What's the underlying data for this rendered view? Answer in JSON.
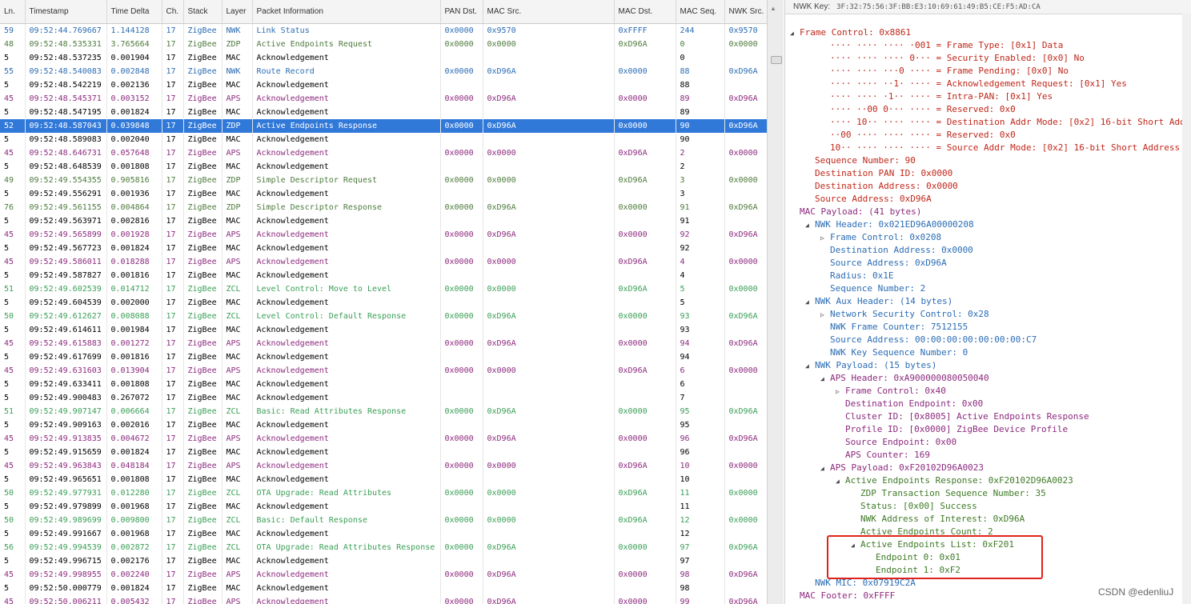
{
  "table": {
    "headers": [
      "Ln.",
      "Timestamp",
      "Time Delta",
      "Ch.",
      "Stack",
      "Layer",
      "Packet Information",
      "PAN Dst.",
      "MAC Src.",
      "MAC Dst.",
      "MAC Seq.",
      "NWK Src."
    ],
    "rows": [
      {
        "cat": "nwk",
        "cells": [
          "59",
          "09:52:44.769667",
          "1.144128",
          "17",
          "ZigBee",
          "NWK",
          "Link Status",
          "0x0000",
          "0x9570",
          "0xFFFF",
          "244",
          "0x9570"
        ]
      },
      {
        "cat": "zdp",
        "cells": [
          "48",
          "09:52:48.535331",
          "3.765664",
          "17",
          "ZigBee",
          "ZDP",
          "Active Endpoints Request",
          "0x0000",
          "0x0000",
          "0xD96A",
          "0",
          "0x0000"
        ]
      },
      {
        "cat": "mac",
        "cells": [
          "5",
          "09:52:48.537235",
          "0.001904",
          "17",
          "ZigBee",
          "MAC",
          "Acknowledgement",
          "",
          "",
          "",
          "0",
          ""
        ]
      },
      {
        "cat": "nwk",
        "cells": [
          "55",
          "09:52:48.540083",
          "0.002848",
          "17",
          "ZigBee",
          "NWK",
          "Route Record",
          "0x0000",
          "0xD96A",
          "0x0000",
          "88",
          "0xD96A"
        ]
      },
      {
        "cat": "mac",
        "cells": [
          "5",
          "09:52:48.542219",
          "0.002136",
          "17",
          "ZigBee",
          "MAC",
          "Acknowledgement",
          "",
          "",
          "",
          "88",
          ""
        ]
      },
      {
        "cat": "aps",
        "cells": [
          "45",
          "09:52:48.545371",
          "0.003152",
          "17",
          "ZigBee",
          "APS",
          "Acknowledgement",
          "0x0000",
          "0xD96A",
          "0x0000",
          "89",
          "0xD96A"
        ]
      },
      {
        "cat": "mac",
        "cells": [
          "5",
          "09:52:48.547195",
          "0.001824",
          "17",
          "ZigBee",
          "MAC",
          "Acknowledgement",
          "",
          "",
          "",
          "89",
          ""
        ]
      },
      {
        "cat": "sel",
        "cells": [
          "52",
          "09:52:48.587043",
          "0.039848",
          "17",
          "ZigBee",
          "ZDP",
          "Active Endpoints Response",
          "0x0000",
          "0xD96A",
          "0x0000",
          "90",
          "0xD96A"
        ]
      },
      {
        "cat": "mac",
        "cells": [
          "5",
          "09:52:48.589083",
          "0.002040",
          "17",
          "ZigBee",
          "MAC",
          "Acknowledgement",
          "",
          "",
          "",
          "90",
          ""
        ]
      },
      {
        "cat": "aps",
        "cells": [
          "45",
          "09:52:48.646731",
          "0.057648",
          "17",
          "ZigBee",
          "APS",
          "Acknowledgement",
          "0x0000",
          "0x0000",
          "0xD96A",
          "2",
          "0x0000"
        ]
      },
      {
        "cat": "mac",
        "cells": [
          "5",
          "09:52:48.648539",
          "0.001808",
          "17",
          "ZigBee",
          "MAC",
          "Acknowledgement",
          "",
          "",
          "",
          "2",
          ""
        ]
      },
      {
        "cat": "zdp",
        "cells": [
          "49",
          "09:52:49.554355",
          "0.905816",
          "17",
          "ZigBee",
          "ZDP",
          "Simple Descriptor Request",
          "0x0000",
          "0x0000",
          "0xD96A",
          "3",
          "0x0000"
        ]
      },
      {
        "cat": "mac",
        "cells": [
          "5",
          "09:52:49.556291",
          "0.001936",
          "17",
          "ZigBee",
          "MAC",
          "Acknowledgement",
          "",
          "",
          "",
          "3",
          ""
        ]
      },
      {
        "cat": "zdp",
        "cells": [
          "76",
          "09:52:49.561155",
          "0.004864",
          "17",
          "ZigBee",
          "ZDP",
          "Simple Descriptor Response",
          "0x0000",
          "0xD96A",
          "0x0000",
          "91",
          "0xD96A"
        ]
      },
      {
        "cat": "mac",
        "cells": [
          "5",
          "09:52:49.563971",
          "0.002816",
          "17",
          "ZigBee",
          "MAC",
          "Acknowledgement",
          "",
          "",
          "",
          "91",
          ""
        ]
      },
      {
        "cat": "aps",
        "cells": [
          "45",
          "09:52:49.565899",
          "0.001928",
          "17",
          "ZigBee",
          "APS",
          "Acknowledgement",
          "0x0000",
          "0xD96A",
          "0x0000",
          "92",
          "0xD96A"
        ]
      },
      {
        "cat": "mac",
        "cells": [
          "5",
          "09:52:49.567723",
          "0.001824",
          "17",
          "ZigBee",
          "MAC",
          "Acknowledgement",
          "",
          "",
          "",
          "92",
          ""
        ]
      },
      {
        "cat": "aps",
        "cells": [
          "45",
          "09:52:49.586011",
          "0.018288",
          "17",
          "ZigBee",
          "APS",
          "Acknowledgement",
          "0x0000",
          "0x0000",
          "0xD96A",
          "4",
          "0x0000"
        ]
      },
      {
        "cat": "mac",
        "cells": [
          "5",
          "09:52:49.587827",
          "0.001816",
          "17",
          "ZigBee",
          "MAC",
          "Acknowledgement",
          "",
          "",
          "",
          "4",
          ""
        ]
      },
      {
        "cat": "zcl",
        "cells": [
          "51",
          "09:52:49.602539",
          "0.014712",
          "17",
          "ZigBee",
          "ZCL",
          "Level Control: Move to Level",
          "0x0000",
          "0x0000",
          "0xD96A",
          "5",
          "0x0000"
        ]
      },
      {
        "cat": "mac",
        "cells": [
          "5",
          "09:52:49.604539",
          "0.002000",
          "17",
          "ZigBee",
          "MAC",
          "Acknowledgement",
          "",
          "",
          "",
          "5",
          ""
        ]
      },
      {
        "cat": "zcl",
        "cells": [
          "50",
          "09:52:49.612627",
          "0.008088",
          "17",
          "ZigBee",
          "ZCL",
          "Level Control: Default Response",
          "0x0000",
          "0xD96A",
          "0x0000",
          "93",
          "0xD96A"
        ]
      },
      {
        "cat": "mac",
        "cells": [
          "5",
          "09:52:49.614611",
          "0.001984",
          "17",
          "ZigBee",
          "MAC",
          "Acknowledgement",
          "",
          "",
          "",
          "93",
          ""
        ]
      },
      {
        "cat": "aps",
        "cells": [
          "45",
          "09:52:49.615883",
          "0.001272",
          "17",
          "ZigBee",
          "APS",
          "Acknowledgement",
          "0x0000",
          "0xD96A",
          "0x0000",
          "94",
          "0xD96A"
        ]
      },
      {
        "cat": "mac",
        "cells": [
          "5",
          "09:52:49.617699",
          "0.001816",
          "17",
          "ZigBee",
          "MAC",
          "Acknowledgement",
          "",
          "",
          "",
          "94",
          ""
        ]
      },
      {
        "cat": "aps",
        "cells": [
          "45",
          "09:52:49.631603",
          "0.013904",
          "17",
          "ZigBee",
          "APS",
          "Acknowledgement",
          "0x0000",
          "0x0000",
          "0xD96A",
          "6",
          "0x0000"
        ]
      },
      {
        "cat": "mac",
        "cells": [
          "5",
          "09:52:49.633411",
          "0.001808",
          "17",
          "ZigBee",
          "MAC",
          "Acknowledgement",
          "",
          "",
          "",
          "6",
          ""
        ]
      },
      {
        "cat": "mac",
        "cells": [
          "5",
          "09:52:49.900483",
          "0.267072",
          "17",
          "ZigBee",
          "MAC",
          "Acknowledgement",
          "",
          "",
          "",
          "7",
          ""
        ]
      },
      {
        "cat": "zcl",
        "cells": [
          "51",
          "09:52:49.907147",
          "0.006664",
          "17",
          "ZigBee",
          "ZCL",
          "Basic: Read Attributes Response",
          "0x0000",
          "0xD96A",
          "0x0000",
          "95",
          "0xD96A"
        ]
      },
      {
        "cat": "mac",
        "cells": [
          "5",
          "09:52:49.909163",
          "0.002016",
          "17",
          "ZigBee",
          "MAC",
          "Acknowledgement",
          "",
          "",
          "",
          "95",
          ""
        ]
      },
      {
        "cat": "aps",
        "cells": [
          "45",
          "09:52:49.913835",
          "0.004672",
          "17",
          "ZigBee",
          "APS",
          "Acknowledgement",
          "0x0000",
          "0xD96A",
          "0x0000",
          "96",
          "0xD96A"
        ]
      },
      {
        "cat": "mac",
        "cells": [
          "5",
          "09:52:49.915659",
          "0.001824",
          "17",
          "ZigBee",
          "MAC",
          "Acknowledgement",
          "",
          "",
          "",
          "96",
          ""
        ]
      },
      {
        "cat": "aps",
        "cells": [
          "45",
          "09:52:49.963843",
          "0.048184",
          "17",
          "ZigBee",
          "APS",
          "Acknowledgement",
          "0x0000",
          "0x0000",
          "0xD96A",
          "10",
          "0x0000"
        ]
      },
      {
        "cat": "mac",
        "cells": [
          "5",
          "09:52:49.965651",
          "0.001808",
          "17",
          "ZigBee",
          "MAC",
          "Acknowledgement",
          "",
          "",
          "",
          "10",
          ""
        ]
      },
      {
        "cat": "zcl",
        "cells": [
          "50",
          "09:52:49.977931",
          "0.012280",
          "17",
          "ZigBee",
          "ZCL",
          "OTA Upgrade: Read Attributes",
          "0x0000",
          "0x0000",
          "0xD96A",
          "11",
          "0x0000"
        ]
      },
      {
        "cat": "mac",
        "cells": [
          "5",
          "09:52:49.979899",
          "0.001968",
          "17",
          "ZigBee",
          "MAC",
          "Acknowledgement",
          "",
          "",
          "",
          "11",
          ""
        ]
      },
      {
        "cat": "zcl",
        "cells": [
          "50",
          "09:52:49.989699",
          "0.009800",
          "17",
          "ZigBee",
          "ZCL",
          "Basic: Default Response",
          "0x0000",
          "0x0000",
          "0xD96A",
          "12",
          "0x0000"
        ]
      },
      {
        "cat": "mac",
        "cells": [
          "5",
          "09:52:49.991667",
          "0.001968",
          "17",
          "ZigBee",
          "MAC",
          "Acknowledgement",
          "",
          "",
          "",
          "12",
          ""
        ]
      },
      {
        "cat": "zcl",
        "cells": [
          "56",
          "09:52:49.994539",
          "0.002872",
          "17",
          "ZigBee",
          "ZCL",
          "OTA Upgrade: Read Attributes Response",
          "0x0000",
          "0xD96A",
          "0x0000",
          "97",
          "0xD96A"
        ]
      },
      {
        "cat": "mac",
        "cells": [
          "5",
          "09:52:49.996715",
          "0.002176",
          "17",
          "ZigBee",
          "MAC",
          "Acknowledgement",
          "",
          "",
          "",
          "97",
          ""
        ]
      },
      {
        "cat": "aps",
        "cells": [
          "45",
          "09:52:49.998955",
          "0.002240",
          "17",
          "ZigBee",
          "APS",
          "Acknowledgement",
          "0x0000",
          "0xD96A",
          "0x0000",
          "98",
          "0xD96A"
        ]
      },
      {
        "cat": "mac",
        "cells": [
          "5",
          "09:52:50.000779",
          "0.001824",
          "17",
          "ZigBee",
          "MAC",
          "Acknowledgement",
          "",
          "",
          "",
          "98",
          ""
        ]
      },
      {
        "cat": "aps",
        "cells": [
          "45",
          "09:52:50.006211",
          "0.005432",
          "17",
          "ZigBee",
          "APS",
          "Acknowledgement",
          "0x0000",
          "0xD96A",
          "0x0000",
          "99",
          "0xD96A"
        ]
      }
    ]
  },
  "detail": {
    "nwk_key_label": "NWK Key:",
    "nwk_key_value": "3F:32:75:56:3F:BB:E3:10:69:61:49:B5:CE:F5:AD:CA",
    "lines": [
      {
        "t": "Frame Control: 0x8861",
        "c": "red",
        "tog": "open",
        "ind": 0
      },
      {
        "t": "···· ···· ···· ·001 = Frame Type: [0x1] Data",
        "c": "red",
        "tog": "",
        "ind": 2
      },
      {
        "t": "···· ···· ···· 0··· = Security Enabled: [0x0] No",
        "c": "red",
        "tog": "",
        "ind": 2
      },
      {
        "t": "···· ···· ···0 ···· = Frame Pending: [0x0] No",
        "c": "red",
        "tog": "",
        "ind": 2
      },
      {
        "t": "···· ···· ··1· ···· = Acknowledgement Request: [0x1] Yes",
        "c": "red",
        "tog": "",
        "ind": 2
      },
      {
        "t": "···· ···· ·1·· ···· = Intra-PAN: [0x1] Yes",
        "c": "red",
        "tog": "",
        "ind": 2
      },
      {
        "t": "···· ··00 0··· ···· = Reserved: 0x0",
        "c": "red",
        "tog": "",
        "ind": 2
      },
      {
        "t": "···· 10·· ···· ···· = Destination Addr Mode: [0x2] 16-bit Short Addre",
        "c": "red",
        "tog": "",
        "ind": 2
      },
      {
        "t": "··00 ···· ···· ···· = Reserved: 0x0",
        "c": "red",
        "tog": "",
        "ind": 2
      },
      {
        "t": "10·· ···· ···· ···· = Source Addr Mode: [0x2] 16-bit Short Address",
        "c": "red",
        "tog": "",
        "ind": 2
      },
      {
        "t": "Sequence Number: 90",
        "c": "red",
        "tog": "",
        "ind": 1
      },
      {
        "t": "Destination PAN ID: 0x0000",
        "c": "red",
        "tog": "",
        "ind": 1
      },
      {
        "t": "Destination Address: 0x0000",
        "c": "red",
        "tog": "",
        "ind": 1
      },
      {
        "t": "Source Address: 0xD96A",
        "c": "red",
        "tog": "",
        "ind": 1
      },
      {
        "t": "MAC Payload: (41 bytes)",
        "c": "purple",
        "tog": "",
        "ind": 0
      },
      {
        "t": "NWK Header: 0x021ED96A00000208",
        "c": "blue",
        "tog": "open",
        "ind": 1
      },
      {
        "t": "Frame Control: 0x0208",
        "c": "blue",
        "tog": "closed",
        "ind": 2
      },
      {
        "t": "Destination Address: 0x0000",
        "c": "blue",
        "tog": "",
        "ind": 2
      },
      {
        "t": "Source Address: 0xD96A",
        "c": "blue",
        "tog": "",
        "ind": 2
      },
      {
        "t": "Radius: 0x1E",
        "c": "blue",
        "tog": "",
        "ind": 2
      },
      {
        "t": "Sequence Number: 2",
        "c": "blue",
        "tog": "",
        "ind": 2
      },
      {
        "t": "NWK Aux Header: (14 bytes)",
        "c": "blue",
        "tog": "open",
        "ind": 1
      },
      {
        "t": "Network Security Control: 0x28",
        "c": "blue",
        "tog": "closed",
        "ind": 2
      },
      {
        "t": "NWK Frame Counter: 7512155",
        "c": "blue",
        "tog": "",
        "ind": 2
      },
      {
        "t": "Source Address: 00:00:00:00:00:00:00:C7",
        "c": "blue",
        "tog": "",
        "ind": 2
      },
      {
        "t": "NWK Key Sequence Number: 0",
        "c": "blue",
        "tog": "",
        "ind": 2
      },
      {
        "t": "NWK Payload: (15 bytes)",
        "c": "blue",
        "tog": "open",
        "ind": 1
      },
      {
        "t": "APS Header: 0xA900000080050040",
        "c": "purple",
        "tog": "open",
        "ind": 2
      },
      {
        "t": "Frame Control: 0x40",
        "c": "purple",
        "tog": "closed",
        "ind": 3
      },
      {
        "t": "Destination Endpoint: 0x00",
        "c": "purple",
        "tog": "",
        "ind": 3
      },
      {
        "t": "Cluster ID: [0x8005] Active Endpoints Response",
        "c": "purple",
        "tog": "",
        "ind": 3
      },
      {
        "t": "Profile ID: [0x0000] ZigBee Device Profile",
        "c": "purple",
        "tog": "",
        "ind": 3
      },
      {
        "t": "Source Endpoint: 0x00",
        "c": "purple",
        "tog": "",
        "ind": 3
      },
      {
        "t": "APS Counter: 169",
        "c": "purple",
        "tog": "",
        "ind": 3
      },
      {
        "t": "APS Payload: 0xF20102D96A0023",
        "c": "purple",
        "tog": "open",
        "ind": 2
      },
      {
        "t": "Active Endpoints Response: 0xF20102D96A0023",
        "c": "green",
        "tog": "open",
        "ind": 3
      },
      {
        "t": "ZDP Transaction Sequence Number: 35",
        "c": "green",
        "tog": "",
        "ind": 4
      },
      {
        "t": "Status: [0x00] Success",
        "c": "green",
        "tog": "",
        "ind": 4
      },
      {
        "t": "NWK Address of Interest: 0xD96A",
        "c": "green",
        "tog": "",
        "ind": 4
      },
      {
        "t": "Active Endpoints Count: 2",
        "c": "green",
        "tog": "",
        "ind": 4
      },
      {
        "t": "Active Endpoints List: 0xF201",
        "c": "green",
        "tog": "open",
        "ind": 4
      },
      {
        "t": "Endpoint 0: 0x01",
        "c": "green",
        "tog": "",
        "ind": 5
      },
      {
        "t": "Endpoint 1: 0xF2",
        "c": "green",
        "tog": "",
        "ind": 5
      },
      {
        "t": "NWK MIC: 0x07919C2A",
        "c": "blue",
        "tog": "",
        "ind": 1
      },
      {
        "t": "MAC Footer: 0xFFFF",
        "c": "purple",
        "tog": "",
        "ind": 0
      }
    ]
  },
  "watermark": "CSDN @edenliuJ",
  "colors": {
    "selection": "#3179d9",
    "nwk": "#2b6cb4",
    "zdp": "#4d7a3c",
    "aps": "#8c2a7e",
    "zcl": "#3a9e56",
    "mac_header": "#c0271a",
    "highlight_box": "#e0231a"
  }
}
